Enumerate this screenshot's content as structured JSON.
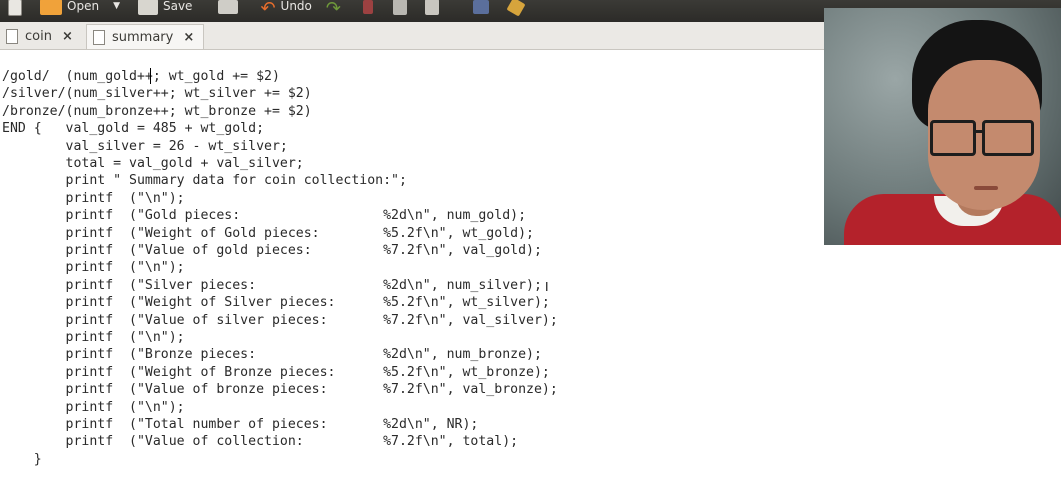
{
  "toolbar": {
    "open_label": "Open",
    "save_label": "Save",
    "undo_label": "Undo"
  },
  "tabs": [
    {
      "label": "coin",
      "active": false
    },
    {
      "label": "summary",
      "active": true
    }
  ],
  "editor": {
    "lines": [
      "/gold/  (num_gold++; wt_gold += $2)",
      "/silver/(num_silver++; wt_silver += $2)",
      "/bronze/(num_bronze++; wt_bronze += $2)",
      "END {   val_gold = 485 + wt_gold;",
      "        val_silver = 26 - wt_silver;",
      "        total = val_gold + val_silver;",
      "        print \" Summary data for coin collection:\";",
      "        printf  (\"\\n\");",
      "        printf  (\"Gold pieces:                  %2d\\n\", num_gold);",
      "        printf  (\"Weight of Gold pieces:        %5.2f\\n\", wt_gold);",
      "        printf  (\"Value of gold pieces:         %7.2f\\n\", val_gold);",
      "        printf  (\"\\n\");",
      "        printf  (\"Silver pieces:                %2d\\n\", num_silver);",
      "        printf  (\"Weight of Silver pieces:      %5.2f\\n\", wt_silver);",
      "        printf  (\"Value of silver pieces:       %7.2f\\n\", val_silver);",
      "        printf  (\"\\n\");",
      "        printf  (\"Bronze pieces:                %2d\\n\", num_bronze);",
      "        printf  (\"Weight of Bronze pieces:      %5.2f\\n\", wt_bronze);",
      "        printf  (\"Value of bronze pieces:       %7.2f\\n\", val_bronze);",
      "        printf  (\"\\n\");",
      "        printf  (\"Total number of pieces:       %2d\\n\", NR);",
      "        printf  (\"Value of collection:          %7.2f\\n\", total);",
      "    }"
    ]
  }
}
